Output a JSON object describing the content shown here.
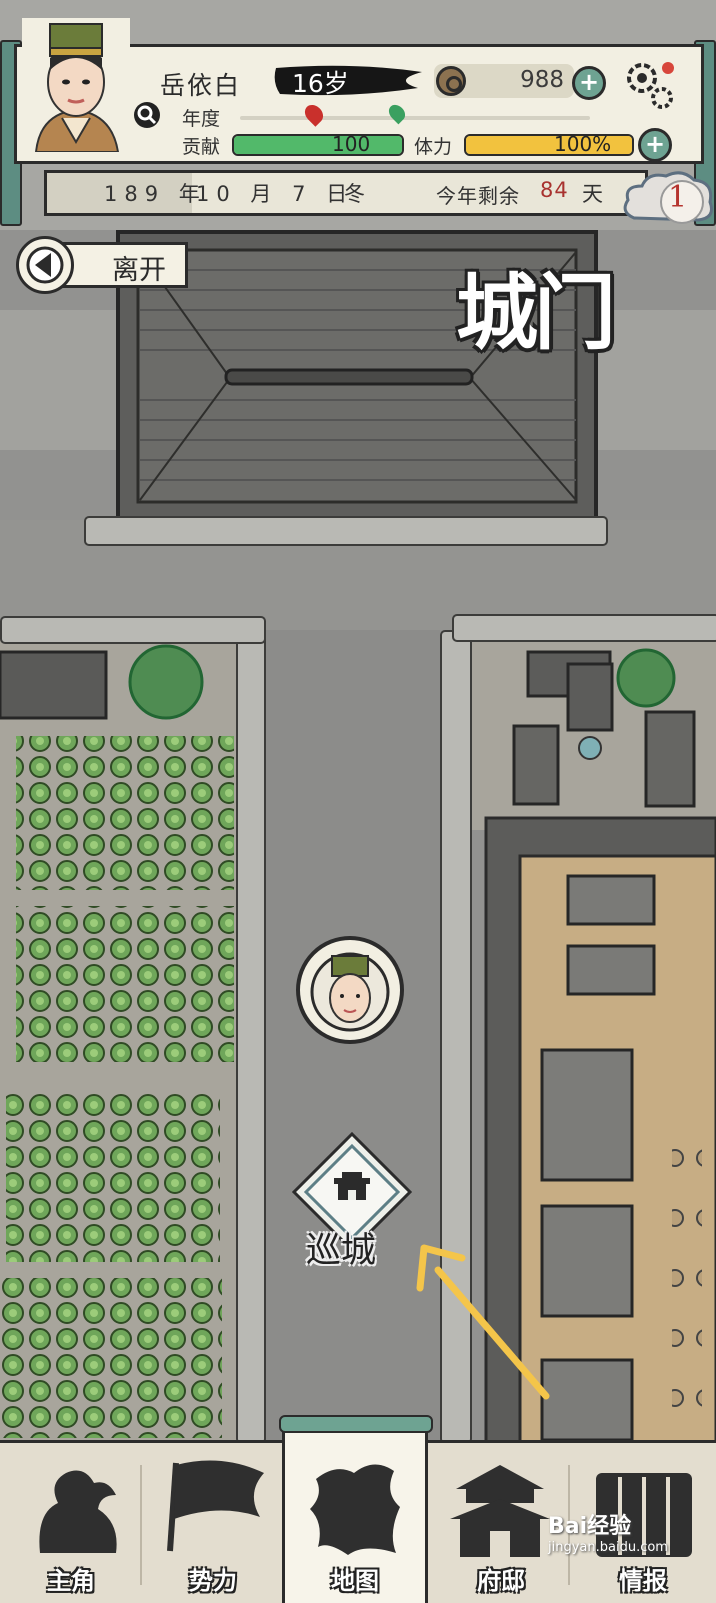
{
  "player": {
    "name": "岳依白",
    "age": "16岁",
    "coins": "988",
    "annual_label": "年度",
    "contribution_label": "贡献",
    "contribution_value": "100",
    "contribution_fraction": 1.0,
    "stamina_label": "体力",
    "stamina_value": "100%",
    "stamina_fraction": 1.0
  },
  "date": {
    "year": "189 年",
    "month_day": "10 月 7 日",
    "season": "冬",
    "remaining_label": "今年剩余",
    "remaining_days": "84",
    "remaining_unit": "天"
  },
  "notification_count": "1",
  "leave_label": "离开",
  "location_title": "城门",
  "action": {
    "label": "巡城"
  },
  "nav": {
    "items": [
      {
        "label": "主角"
      },
      {
        "label": "势力"
      },
      {
        "label": "地图"
      },
      {
        "label": "府邸"
      },
      {
        "label": "情报"
      }
    ],
    "active_index": 2
  },
  "watermark": {
    "text": "Bai经验",
    "sub": "jingyan.baidu.com"
  },
  "colors": {
    "contribution_bar": "#52b96a",
    "stamina_bar": "#f2c23e",
    "accent_teal": "#5d8d82",
    "panel_bg": "#f2efe2",
    "days_red": "#a8322f"
  }
}
